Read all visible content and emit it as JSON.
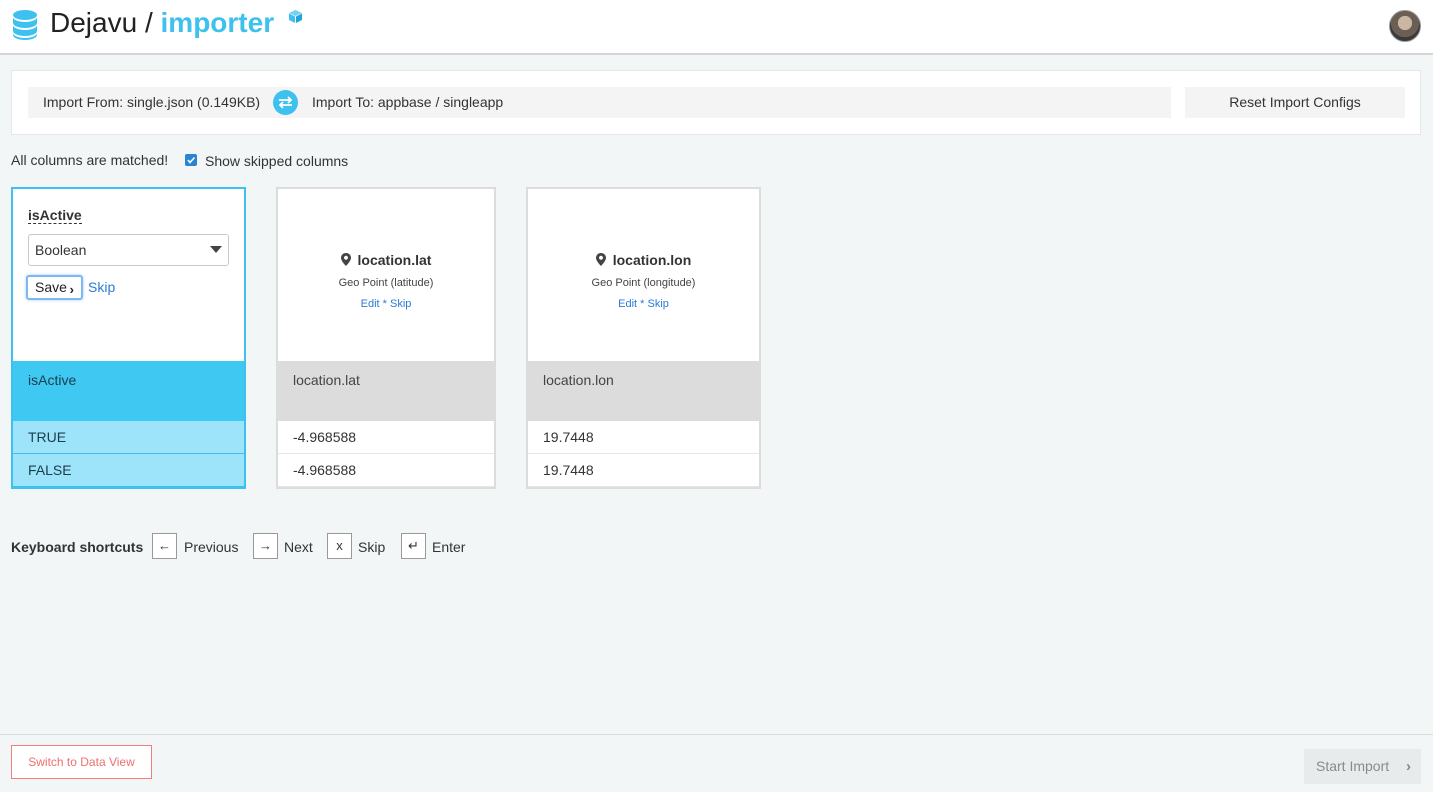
{
  "header": {
    "app_name": "Dejavu",
    "separator": "/",
    "tool_name": "importer",
    "logo_icon": "database-stack-icon",
    "badge_icon": "cube-icon",
    "avatar_icon": "user-avatar",
    "accent_color": "#3ec1ee"
  },
  "import_bar": {
    "from_text": "Import From: single.json (0.149KB)",
    "swap_icon": "swap-arrows-icon",
    "to_text": "Import To: appbase / singleapp",
    "reset_label": "Reset Import Configs"
  },
  "status": {
    "matched_text": "All columns are matched!",
    "show_skipped_label": "Show skipped columns",
    "show_skipped_checked": true
  },
  "columns": [
    {
      "name": "isActive",
      "editing": true,
      "selected_type": "Boolean",
      "save_label": "Save",
      "skip_label": "Skip",
      "header": "isActive",
      "values": [
        "TRUE",
        "FALSE"
      ]
    },
    {
      "name": "location.lat",
      "editing": false,
      "type_label": "Geo Point (latitude)",
      "edit_label": "Edit",
      "action_sep": "*",
      "skip_label": "Skip",
      "header": "location.lat",
      "values": [
        "-4.968588",
        "-4.968588"
      ]
    },
    {
      "name": "location.lon",
      "editing": false,
      "type_label": "Geo Point (longitude)",
      "edit_label": "Edit",
      "action_sep": "*",
      "skip_label": "Skip",
      "header": "location.lon",
      "values": [
        "19.7448",
        "19.7448"
      ]
    }
  ],
  "shortcuts": {
    "title": "Keyboard shortcuts",
    "items": [
      {
        "key": "←",
        "label": "Previous"
      },
      {
        "key": "→",
        "label": "Next"
      },
      {
        "key": "x",
        "label": "Skip"
      },
      {
        "key": "↵",
        "label": "Enter"
      }
    ]
  },
  "footer": {
    "switch_label": "Switch to Data View",
    "start_label": "Start Import",
    "start_enabled": false
  }
}
